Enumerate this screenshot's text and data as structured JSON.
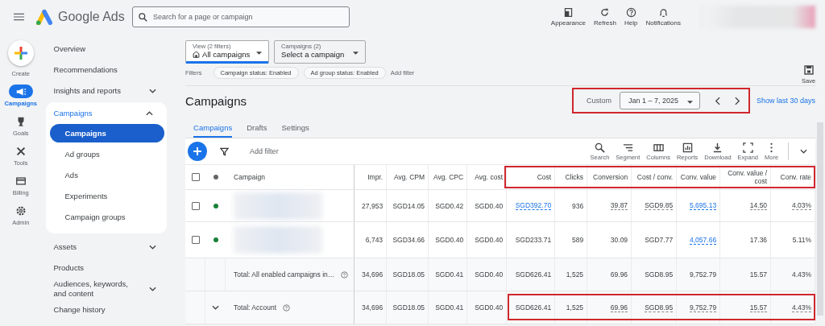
{
  "header": {
    "product": "Google Ads",
    "search": {
      "placeholder": "Search for a page or campaign"
    },
    "actions": [
      {
        "label": "Appearance"
      },
      {
        "label": "Refresh"
      },
      {
        "label": "Help"
      },
      {
        "label": "Notifications"
      }
    ]
  },
  "rail": [
    {
      "label": "Create",
      "selected": false
    },
    {
      "label": "Campaigns",
      "selected": true
    },
    {
      "label": "Goals",
      "selected": false
    },
    {
      "label": "Tools",
      "selected": false
    },
    {
      "label": "Billing",
      "selected": false
    },
    {
      "label": "Admin",
      "selected": false
    }
  ],
  "nav": [
    {
      "label": "Overview"
    },
    {
      "label": "Recommendations"
    },
    {
      "label": "Insights and reports",
      "expanded": false
    },
    {
      "label": "Campaigns",
      "expanded": true,
      "children": [
        {
          "label": "Campaigns",
          "selected": true
        },
        {
          "label": "Ad groups",
          "selected": false
        },
        {
          "label": "Ads",
          "selected": false
        },
        {
          "label": "Experiments",
          "selected": false
        },
        {
          "label": "Campaign groups",
          "selected": false
        }
      ]
    },
    {
      "label": "Assets",
      "expanded": false
    },
    {
      "label": "Products"
    },
    {
      "label": "Audiences, keywords, and content",
      "expanded": false
    },
    {
      "label": "Change history"
    }
  ],
  "view_selector": {
    "label": "View (2 filters)",
    "value": "All campaigns"
  },
  "campaign_selector": {
    "label": "Campaigns (2)",
    "value": "Select a campaign"
  },
  "filters": {
    "label": "Filters",
    "chips": [
      "Campaign status: Enabled",
      "Ad group status: Enabled"
    ],
    "add": "Add filter"
  },
  "save": "Save",
  "page_title": "Campaigns",
  "date_range": {
    "label": "Custom",
    "value": "Jan 1 – 7, 2025",
    "highlighted": true,
    "link": "Show last 30 days"
  },
  "tabs": [
    {
      "label": "Campaigns",
      "selected": true
    },
    {
      "label": "Drafts",
      "selected": false
    },
    {
      "label": "Settings",
      "selected": false
    }
  ],
  "table_toolbar": {
    "add_filter": "Add filter",
    "tools": [
      {
        "label": "Search"
      },
      {
        "label": "Segment"
      },
      {
        "label": "Columns"
      },
      {
        "label": "Reports"
      },
      {
        "label": "Download"
      },
      {
        "label": "Expand"
      },
      {
        "label": "More"
      }
    ]
  },
  "table": {
    "select_all_checked": false,
    "name_column": "Campaign",
    "columns": [
      "Impr.",
      "Avg. CPM",
      "Avg. CPC",
      "Avg. cost",
      "Cost",
      "Clicks",
      "Conversion",
      "Cost / conv.",
      "Conv. value",
      "Conv. value / cost",
      "Conv. rate"
    ],
    "metric_headers_highlighted": true,
    "rows": [
      {
        "kind": "campaign",
        "checked": false,
        "color": "#188038",
        "highlighted": false,
        "cells": [
          {
            "text": "27,953",
            "kind": "plain"
          },
          {
            "text": "SGD14.05",
            "kind": "plain"
          },
          {
            "text": "SGD0.42",
            "kind": "plain"
          },
          {
            "text": "SGD0.40",
            "kind": "plain"
          },
          {
            "text": "SGD392.70",
            "kind": "link"
          },
          {
            "text": "936",
            "kind": "plain"
          },
          {
            "text": "39.87",
            "kind": "dotted"
          },
          {
            "text": "SGD9.85",
            "kind": "dotted"
          },
          {
            "text": "5,695.13",
            "kind": "link"
          },
          {
            "text": "14.50",
            "kind": "dotted"
          },
          {
            "text": "4.03%",
            "kind": "dotted"
          }
        ]
      },
      {
        "kind": "campaign",
        "checked": false,
        "color": "#188038",
        "highlighted": false,
        "cells": [
          {
            "text": "6,743",
            "kind": "plain"
          },
          {
            "text": "SGD34.66",
            "kind": "plain"
          },
          {
            "text": "SGD0.40",
            "kind": "plain"
          },
          {
            "text": "SGD0.40",
            "kind": "plain"
          },
          {
            "text": "SGD233.71",
            "kind": "plain"
          },
          {
            "text": "589",
            "kind": "plain"
          },
          {
            "text": "30.09",
            "kind": "plain"
          },
          {
            "text": "SGD7.77",
            "kind": "plain"
          },
          {
            "text": "4,057.66",
            "kind": "link"
          },
          {
            "text": "17.36",
            "kind": "plain"
          },
          {
            "text": "5.11%",
            "kind": "plain"
          }
        ]
      },
      {
        "kind": "total",
        "label": "Total: All enabled campaigns in…",
        "highlighted": false,
        "cells": [
          {
            "text": "34,696",
            "kind": "plain"
          },
          {
            "text": "SGD18.05",
            "kind": "plain"
          },
          {
            "text": "SGD0.41",
            "kind": "plain"
          },
          {
            "text": "SGD0.40",
            "kind": "plain"
          },
          {
            "text": "SGD626.41",
            "kind": "plain"
          },
          {
            "text": "1,525",
            "kind": "plain"
          },
          {
            "text": "69.96",
            "kind": "plain"
          },
          {
            "text": "SGD8.95",
            "kind": "plain"
          },
          {
            "text": "9,752.79",
            "kind": "plain"
          },
          {
            "text": "15.57",
            "kind": "plain"
          },
          {
            "text": "4.43%",
            "kind": "plain"
          }
        ]
      },
      {
        "kind": "account_total",
        "label": "Total: Account",
        "expanded": false,
        "highlighted": true,
        "cells": [
          {
            "text": "34,696",
            "kind": "plain"
          },
          {
            "text": "SGD18.05",
            "kind": "plain"
          },
          {
            "text": "SGD0.41",
            "kind": "plain"
          },
          {
            "text": "SGD0.40",
            "kind": "plain"
          },
          {
            "text": "SGD626.41",
            "kind": "plain"
          },
          {
            "text": "1,525",
            "kind": "plain"
          },
          {
            "text": "69.96",
            "kind": "dotted"
          },
          {
            "text": "SGD8.95",
            "kind": "dotted"
          },
          {
            "text": "9,752.79",
            "kind": "dotted"
          },
          {
            "text": "15.57",
            "kind": "dotted"
          },
          {
            "text": "4.43%",
            "kind": "dotted"
          }
        ]
      }
    ]
  }
}
